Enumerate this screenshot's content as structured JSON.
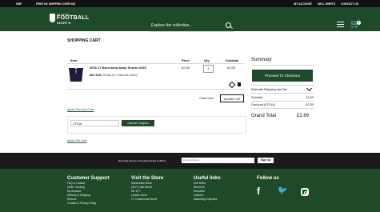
{
  "top_bar": {
    "currency": "GBP",
    "shipping": "FREE UK SHIPPING OVER £50",
    "links": [
      "MY ACCOUNT",
      "SELL SHIRTS",
      "CONTACT US"
    ]
  },
  "header": {
    "brand_small": "CLASSIC",
    "brand_large": "FOOTBALL",
    "brand_sub": "SHIRTS",
    "search_placeholder": "Explore the collection...",
    "cart_count": "1"
  },
  "page": {
    "title": "SHOPPING CART",
    "table_headers": [
      "Item",
      "Price",
      "Qty",
      "Subtotal"
    ],
    "item": {
      "name": "2016-17 Barcelona Away Shorts KIDS",
      "brand_label": "Nike Kids",
      "size": "XS.Kids (6-7 Years/116-122cm)",
      "price": "£2.69",
      "qty": "1",
      "subtotal": "£2.69"
    },
    "clear_cart": "Clear Cart",
    "update_cart": "Update Cart",
    "discount_link": "Apply Discount Code",
    "coupon_value": "CF316",
    "cancel_coupon": "Cancel Coupon",
    "gift_link": "Apply Gift Card"
  },
  "summary": {
    "title": "Summary",
    "checkout": "Proceed To Checkout",
    "estimate": "Estimate Shipping and Tax",
    "rows": [
      {
        "label": "Subtotal",
        "value": "£2.99"
      },
      {
        "label": "Discount (CF316)",
        "value": "-£0.30"
      }
    ],
    "grand_total_label": "Grand Total",
    "grand_total_value": "£2.69"
  },
  "signup": {
    "text": "Get early access to the latest drops & offers!",
    "placeholder": "E-Mail Address",
    "button": "Sign Up"
  },
  "footer": {
    "customer_support": {
      "title": "Customer Support",
      "links": [
        "FAQ & Contact",
        "Order Tracking",
        "My Account",
        "Delivery & Shipping",
        "Returns",
        "Cookies & Privacy Policy"
      ]
    },
    "visit_store": {
      "title": "Visit the Store",
      "links": [
        "Manchester Store",
        "25-27 Dale Street",
        "M1 1FY",
        "",
        "London Store",
        "17 Commercial Street"
      ]
    },
    "useful_links": {
      "title": "Useful links",
      "links": [
        "Sell Shirts",
        "About Us",
        "Requests",
        "Careers",
        "Marketing Enquiries"
      ]
    },
    "follow_us": {
      "title": "Follow us"
    }
  }
}
